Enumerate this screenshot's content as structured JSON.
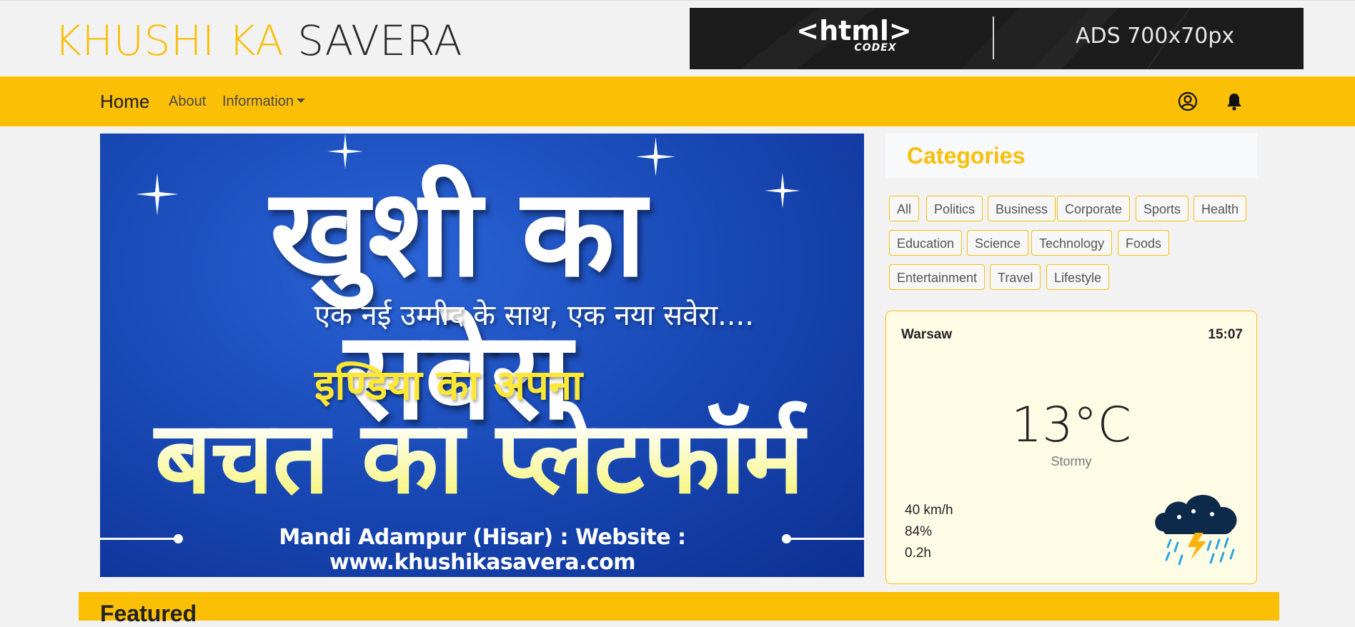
{
  "header": {
    "logo_part1": "KHUSHI KA",
    "logo_part2": "SAVERA",
    "ad": {
      "logo_main": "<html>",
      "logo_sub": "CODEX",
      "text": "ADS 700x70px"
    }
  },
  "nav": {
    "home": "Home",
    "about": "About",
    "information": "Information",
    "icons": [
      "user-circle-icon",
      "bell-icon"
    ]
  },
  "hero": {
    "title": "खुशी का सवेरा",
    "tagline": "एक नई उम्मीद के साथ, एक नया सवेरा....",
    "subtitle": "इण्डिया का अपना",
    "big": "बचत का प्लेटफॉर्म",
    "footer": "Mandi Adampur (Hisar) : Website : www.khushikasavera.com"
  },
  "categories": {
    "title": "Categories",
    "tags": [
      "All",
      "Politics",
      "Business",
      "Corporate",
      "Sports",
      "Health",
      "Education",
      "Science",
      "Technology",
      "Foods",
      "Entertainment",
      "Travel",
      "Lifestyle"
    ]
  },
  "weather": {
    "city": "Warsaw",
    "time": "15:07",
    "temperature": "13°C",
    "condition": "Stormy",
    "wind": "40 km/h",
    "humidity": "84%",
    "precip": "0.2h",
    "icon": "storm-cloud-icon"
  },
  "featured": {
    "title": "Featured"
  },
  "colors": {
    "accent": "#fbbf06",
    "hero_blue": "#1a4bb8",
    "ad_bg": "#1c1c1c"
  }
}
